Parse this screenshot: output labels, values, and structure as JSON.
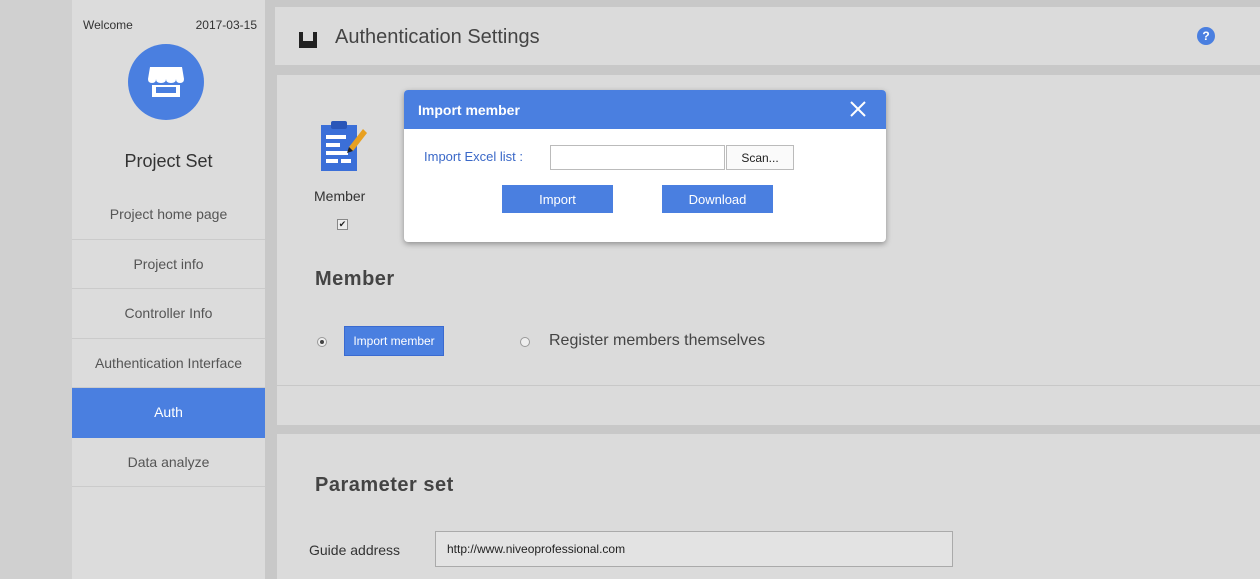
{
  "sidebar": {
    "welcome": "Welcome",
    "date": "2017-03-15",
    "logo_icon": "store-icon",
    "title": "Project Set",
    "items": [
      {
        "label": "Project home page",
        "active": false
      },
      {
        "label": "Project info",
        "active": false
      },
      {
        "label": "Controller Info",
        "active": false
      },
      {
        "label": "Authentication Interface",
        "active": false
      },
      {
        "label": "Auth",
        "active": true
      },
      {
        "label": "Data analyze",
        "active": false
      }
    ]
  },
  "header": {
    "title": "Authentication Settings",
    "help_icon": "?"
  },
  "auth_panel": {
    "member_label": "Member",
    "member_checked": true,
    "member_heading": "Member",
    "import_member_button": "Import member",
    "register_option": "Register members themselves"
  },
  "params_panel": {
    "heading": "Parameter set",
    "guide_label": "Guide address",
    "guide_value": "http://www.niveoprofessional.com"
  },
  "modal": {
    "title": "Import member",
    "excel_label": "Import Excel list :",
    "scan_button": "Scan...",
    "import_button": "Import",
    "download_button": "Download"
  },
  "colors": {
    "accent": "#4a7fe0",
    "sidebar_bg": "#dcdcdc",
    "panel_bg": "#dbdbdb"
  }
}
